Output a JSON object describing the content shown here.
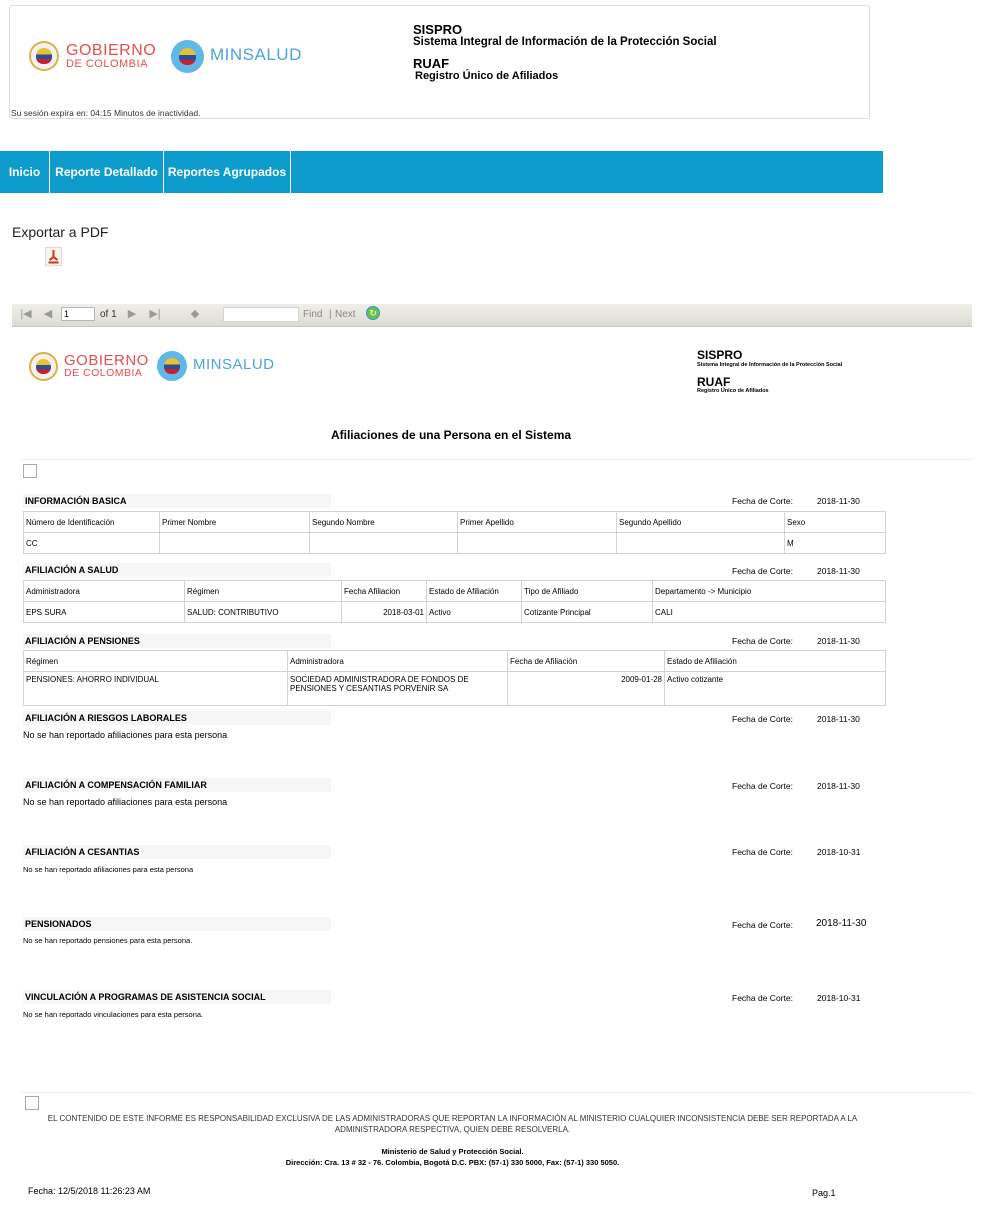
{
  "header": {
    "gobierno_line1": "GOBIERNO",
    "gobierno_line2": "DE COLOMBIA",
    "minsalud": "MINSALUD",
    "sispro": "SISPRO",
    "sispro_full": "Sistema Integral de Información de la Protección Social",
    "ruaf": "RUAF",
    "ruaf_full": "Registro Único de Afiliados",
    "session": "Su sesión expira en: 04:15 Minutos de inactividad."
  },
  "nav": {
    "items": [
      "Inicio",
      "Reporte Detallado",
      "Reportes Agrupados"
    ]
  },
  "export": {
    "label": "Exportar a PDF"
  },
  "toolbar": {
    "page_value": "1",
    "of_label": "of 1",
    "find": "Find",
    "sep": "|",
    "next": "Next"
  },
  "report": {
    "title": "Afiliaciones de una Persona en el Sistema",
    "corte_label": "Fecha de Corte:",
    "basica": {
      "title": "INFORMACIÓN BASICA",
      "fecha": "2018-11-30",
      "headers": [
        "Número de Identificación",
        "Primer Nombre",
        "Segundo Nombre",
        "Primer Apellido",
        "Segundo Apellido",
        "Sexo"
      ],
      "row": [
        "CC",
        "",
        "",
        "",
        "",
        "M"
      ]
    },
    "salud": {
      "title": "AFILIACIÓN A SALUD",
      "fecha": "2018-11-30",
      "headers": [
        "Administradora",
        "Régimen",
        "Fecha Afiliacion",
        "Estado de Afiliación",
        "Tipo de Afiliado",
        "Departamento -> Municipio"
      ],
      "row": [
        "EPS SURA",
        "SALUD: CONTRIBUTIVO",
        "2018-03-01",
        "Activo",
        "Cotizante Principal",
        "CALI"
      ]
    },
    "pensiones": {
      "title": "AFILIACIÓN A PENSIONES",
      "fecha": "2018-11-30",
      "headers": [
        "Régimen",
        "Administradora",
        "Fecha de Afiliación",
        "Estado de Afiliación"
      ],
      "row": [
        "PENSIONES: AHORRO INDIVIDUAL",
        "SOCIEDAD ADMINISTRADORA DE FONDOS DE PENSIONES Y CESANTIAS PORVENIR SA",
        "2009-01-28",
        "Activo cotizante"
      ]
    },
    "riesgos": {
      "title": "AFILIACIÓN A RIESGOS LABORALES",
      "fecha": "2018-11-30",
      "msg": "No se han reportado afiliaciones para esta persona"
    },
    "compensacion": {
      "title": "AFILIACIÓN A COMPENSACIÓN FAMILIAR",
      "fecha": "2018-11-30",
      "msg": "No se han reportado afiliaciones para esta persona"
    },
    "cesantias": {
      "title": "AFILIACIÓN A CESANTIAS",
      "fecha": "2018-10-31",
      "msg": "No se han reportado afiliaciones para esta persona"
    },
    "pensionados": {
      "title": "PENSIONADOS",
      "fecha": "2018-11-30",
      "msg": "No se han reportado pensiones para esta persona."
    },
    "asistencia": {
      "title": "VINCULACIÓN A PROGRAMAS DE  ASISTENCIA SOCIAL",
      "fecha": "2018-10-31",
      "msg": "No se han reportado vinculaciones para esta persona."
    }
  },
  "footer": {
    "disclaimer": "EL CONTENIDO DE ESTE INFORME ES RESPONSABILIDAD EXCLUSIVA DE LAS ADMINISTRADORAS QUE REPORTAN LA INFORMACIÓN AL MINISTERIO CUALQUIER INCONSISTENCIA DEBE SER REPORTADA A LA ADMINISTRADORA RESPECTIVA, QUIEN DEBE RESOLVERLA.",
    "ministerio": "Ministerio de Salud y Protección Social.",
    "direccion": "Dirección: Cra. 13 # 32 - 76. Colombia, Bogotá D.C. PBX: (57-1) 330 5000, Fax: (57-1) 330 5050.",
    "fecha": "Fecha: 12/5/2018 11:26:23 AM",
    "pag": "Pag.1"
  }
}
